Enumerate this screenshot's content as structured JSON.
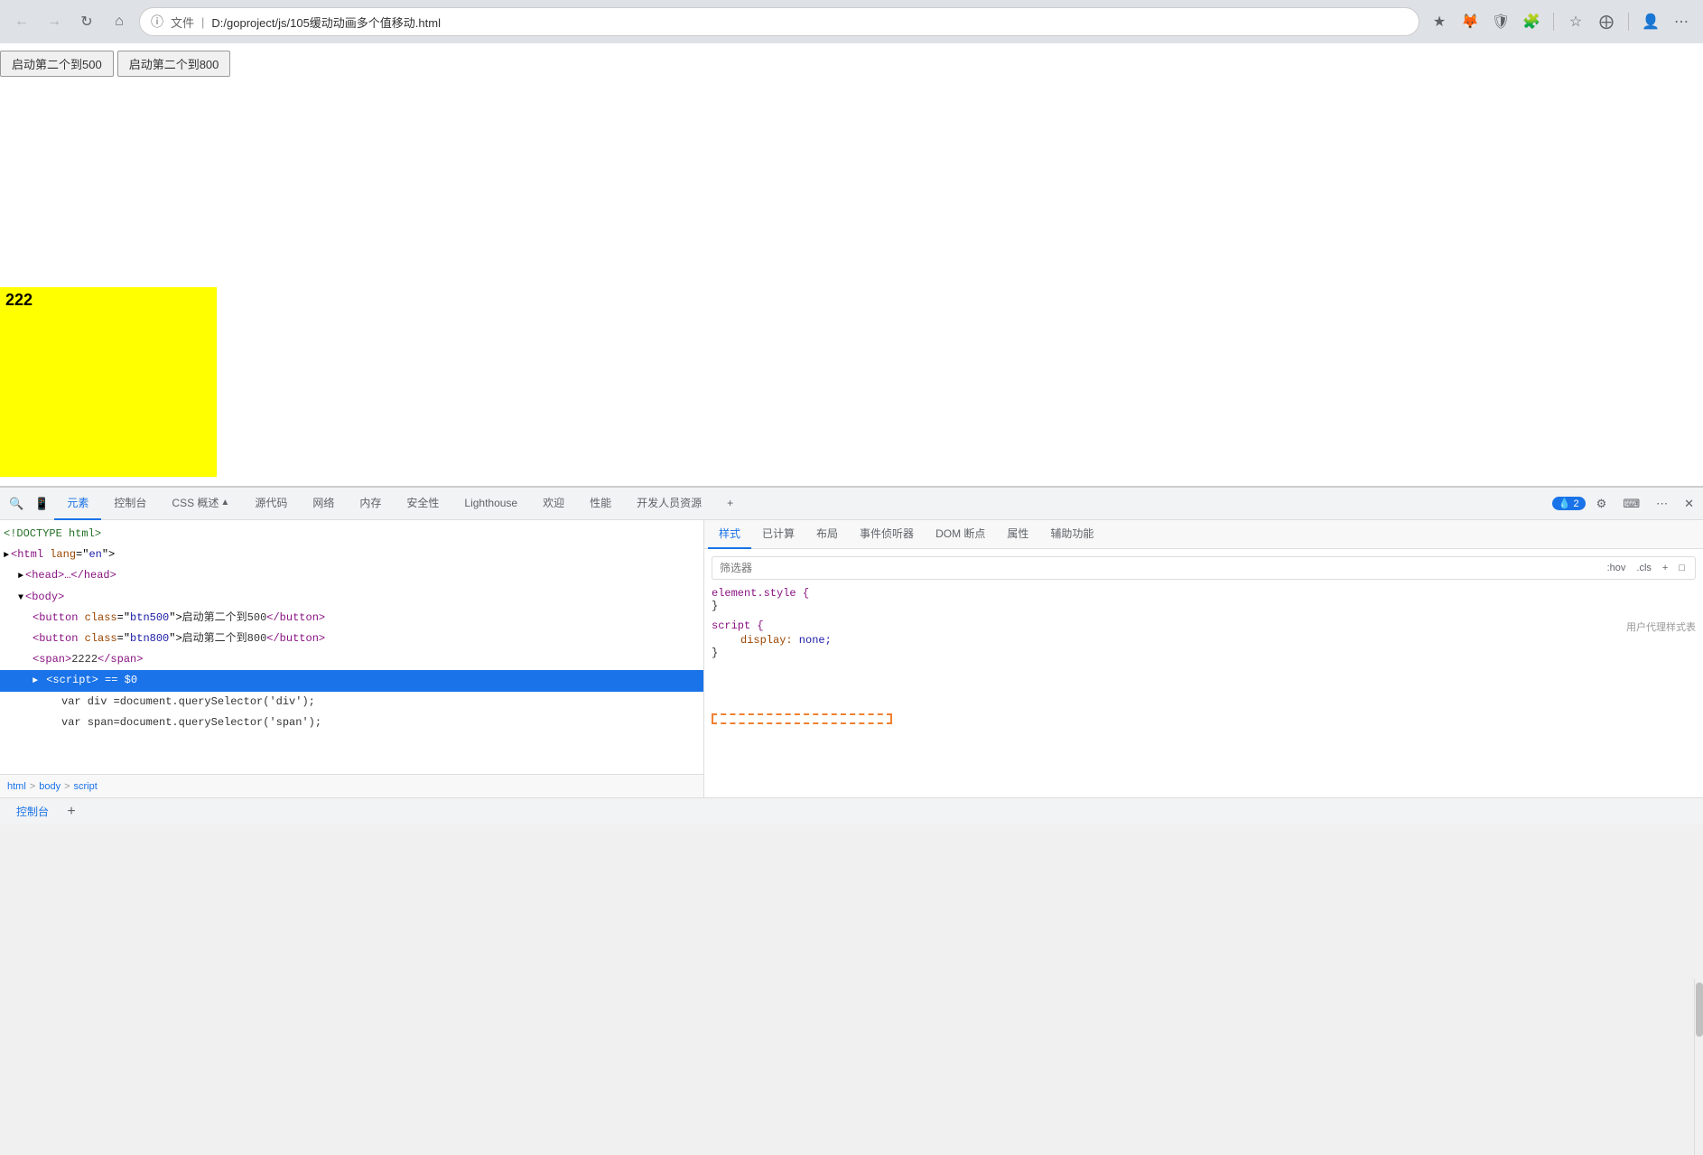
{
  "browser": {
    "back_btn": "←",
    "forward_btn": "→",
    "reload_btn": "↻",
    "home_btn": "⌂",
    "info_icon": "ℹ",
    "file_label": "文件",
    "separator": "|",
    "url": "D:/goproject/js/105缓动动画多个值移动.html",
    "bookmark_icon": "☆",
    "metamask_icon": "🦊",
    "shield_icon": "🛡",
    "puzzle_icon": "🧩",
    "star_icon": "★",
    "tab_icon": "⊞",
    "profile_icon": "👤",
    "menu_icon": "⋯"
  },
  "page": {
    "btn1_label": "启动第二个到500",
    "btn2_label": "启动第二个到800",
    "yellow_box_text": "222",
    "cursor_visible": true
  },
  "devtools": {
    "tabs": [
      {
        "id": "inspect",
        "label": "🔍",
        "icon": true
      },
      {
        "id": "device",
        "label": "📱",
        "icon": true
      },
      {
        "id": "elements",
        "label": "元素",
        "active": true
      },
      {
        "id": "console",
        "label": "控制台"
      },
      {
        "id": "css",
        "label": "CSS 概述",
        "has_icon": true
      },
      {
        "id": "sources",
        "label": "源代码"
      },
      {
        "id": "network",
        "label": "网络"
      },
      {
        "id": "memory",
        "label": "内存"
      },
      {
        "id": "security",
        "label": "安全性"
      },
      {
        "id": "lighthouse",
        "label": "Lighthouse"
      },
      {
        "id": "welcome",
        "label": "欢迎"
      },
      {
        "id": "performance",
        "label": "性能"
      },
      {
        "id": "devresources",
        "label": "开发人员资源"
      },
      {
        "id": "add",
        "label": "+"
      }
    ],
    "actions": {
      "badge": "2",
      "settings_icon": "⚙",
      "remote_icon": "⌨",
      "more_icon": "⋯",
      "close_icon": "✕"
    },
    "dom": {
      "lines": [
        {
          "text": "<!DOCTYPE html>",
          "indent": 0,
          "type": "doctype"
        },
        {
          "text": "<html lang=\"en\">",
          "indent": 0,
          "type": "tag",
          "triangle": "▶"
        },
        {
          "text": "<head>…</head>",
          "indent": 1,
          "type": "tag",
          "triangle": "▶"
        },
        {
          "text": "<body>",
          "indent": 1,
          "type": "tag",
          "triangle": "▼",
          "open": true
        },
        {
          "text": "<button class=\"btn500\">启动第二个到500</button>",
          "indent": 2,
          "type": "tag"
        },
        {
          "text": "<button class=\"btn800\">启动第二个到800</button>",
          "indent": 2,
          "type": "tag"
        },
        {
          "text": "<span>2222</span>",
          "indent": 2,
          "type": "tag"
        },
        {
          "text": "▶ <script> == $0",
          "indent": 2,
          "type": "tag",
          "selected": true,
          "triangle": "▶"
        },
        {
          "text": "var div =document.querySelector('div');",
          "indent": 4,
          "type": "code"
        },
        {
          "text": "var span=document.querySelector('span');",
          "indent": 4,
          "type": "code"
        }
      ]
    },
    "breadcrumb": [
      "html",
      "body",
      "script"
    ],
    "styles": {
      "tabs": [
        {
          "id": "styles",
          "label": "样式",
          "active": true
        },
        {
          "id": "computed",
          "label": "已计算"
        },
        {
          "id": "layout",
          "label": "布局"
        },
        {
          "id": "listeners",
          "label": "事件侦听器"
        },
        {
          "id": "dom_breakpoints",
          "label": "DOM 断点"
        },
        {
          "id": "properties",
          "label": "属性"
        },
        {
          "id": "accessibility",
          "label": "辅助功能"
        }
      ],
      "filter_placeholder": "筛选器",
      "filter_actions": [
        ":hov",
        ".cls",
        "+",
        "□"
      ],
      "rules": [
        {
          "selector": "element.style {",
          "properties": [],
          "close": "}",
          "source": ""
        },
        {
          "selector": "script {",
          "properties": [
            {
              "prop": "display:",
              "val": " none;"
            }
          ],
          "close": "}",
          "source": "用户代理样式表"
        }
      ]
    }
  },
  "bottom_bar": {
    "console_label": "控制台",
    "add_label": "+"
  }
}
